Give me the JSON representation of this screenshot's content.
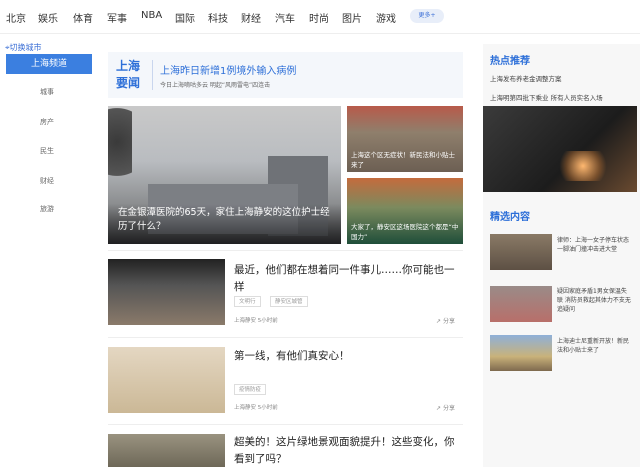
{
  "topnav": {
    "items": [
      "北京",
      "娱乐",
      "体育",
      "军事",
      "NBA",
      "国际",
      "科技",
      "财经",
      "汽车",
      "时尚",
      "图片",
      "游戏"
    ],
    "more": "更多+"
  },
  "sidebar": {
    "switch_city": "切换城市",
    "channel": "上海频道",
    "links": [
      "城事",
      "房产",
      "民生",
      "财经",
      "旅游"
    ]
  },
  "banner": {
    "tag": "上海要闻",
    "headline": "上海昨日新增1例境外输入病例",
    "sub": "今日上海嘀咕多云 明起“风雨雷电”四连击"
  },
  "hero": {
    "caption": "在金银潭医院的65天，家住上海静安的这位护士经历了什么？",
    "slides": 5,
    "active_slide": 1
  },
  "thumbs": [
    {
      "caption": "上海这个区无症状！新民法和小贴士来了"
    },
    {
      "caption": "大家了，静安区这场医院这个都是“中国力”"
    }
  ],
  "feed": [
    {
      "title": "最近，他们都在想着同一件事儿……你可能也一样",
      "tags": [
        "文明行",
        "静安区城管"
      ],
      "meta": "上海静安 5小时前",
      "share": "分享"
    },
    {
      "title": "第一线，有他们真安心！",
      "tags": [
        "疫情防疫"
      ],
      "meta": "上海静安 5小时前",
      "share": "分享"
    },
    {
      "title": "超美的！这片绿地景观面貌提升！这些变化，你看到了吗？"
    }
  ],
  "right": {
    "hot_title": "热点推荐",
    "hot_links": [
      "上海发布养老金调整方案",
      "上海明第四批下乘业 所有人员实名入场"
    ],
    "picks_title": "精选内容",
    "picks": [
      {
        "text": "律师：上海一女子停车状态一脚油门撞冲击进大堂"
      },
      {
        "text": "疑因家庭矛盾1男女保温失联 消防员救起其体力不支无追疑问"
      },
      {
        "text": "上海迪士尼重新开放！新民法和小贴士来了"
      }
    ]
  }
}
